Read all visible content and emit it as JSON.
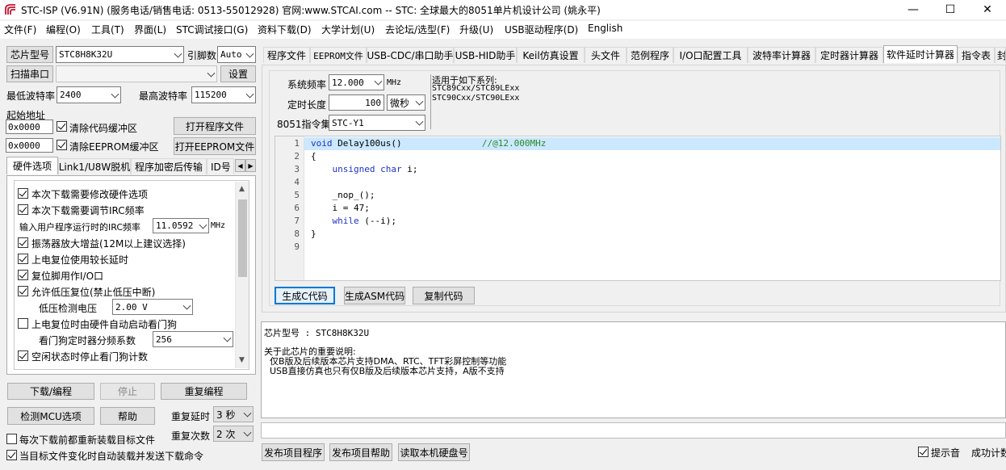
{
  "window": {
    "title": "STC-ISP (V6.91N) (服务电话/销售电话: 0513-55012928) 官网:www.STCAI.com  -- STC: 全球最大的8051单片机设计公司 (姚永平)",
    "minimize": "—",
    "maximize": "☐",
    "close": "✕"
  },
  "menu": [
    "文件(F)",
    "编程(O)",
    "工具(T)",
    "界面(L)",
    "STC调试接口(G)",
    "资料下载(D)",
    "大学计划(U)",
    "去论坛/选型(F)",
    "升级(U)",
    "USB驱动程序(D)",
    "English"
  ],
  "left": {
    "chip_model_label": "芯片型号",
    "chip_model_value": "STC8H8K32U",
    "pin_count_label": "引脚数",
    "pin_count_value": "Auto",
    "scan_port_label": "扫描串口",
    "port_value": "",
    "settings_label": "设置",
    "min_baud_label": "最低波特率",
    "min_baud_value": "2400",
    "max_baud_label": "最高波特率",
    "max_baud_value": "115200",
    "start_addr_label": "起始地址",
    "addr1": "0x0000",
    "clear_code_label": "清除代码缓冲区",
    "open_prog_label": "打开程序文件",
    "addr2": "0x0000",
    "clear_eeprom_label": "清除EEPROM缓冲区",
    "open_eeprom_label": "打开EEPROM文件",
    "tabs": [
      "硬件选项",
      "Link1/U8W脱机",
      "程序加密后传输",
      "ID号"
    ],
    "hw_options": [
      {
        "label": "本次下载需要修改硬件选项",
        "checked": true
      },
      {
        "label": "本次下载需要调节IRC频率",
        "checked": true
      }
    ],
    "irc_label": "输入用户程序运行时的IRC频率",
    "irc_value": "11.0592",
    "irc_unit": "MHz",
    "hw_options2": [
      {
        "label": "振荡器放大增益(12M以上建议选择)",
        "checked": true
      },
      {
        "label": "上电复位使用较长延时",
        "checked": true
      },
      {
        "label": "复位脚用作I/O口",
        "checked": true
      },
      {
        "label": "允许低压复位(禁止低压中断)",
        "checked": true
      }
    ],
    "lv_label": "低压检测电压",
    "lv_value": "2.00 V",
    "wdt_auto_label": "上电复位时由硬件自动启动看门狗",
    "wdt_div_label": "看门狗定时器分频系数",
    "wdt_div_value": "256",
    "idle_wdt_label": "空闲状态时停止看门狗计数",
    "download_label": "下载/编程",
    "stop_label": "停止",
    "reprog_label": "重复编程",
    "detect_label": "检测MCU选项",
    "help_label": "帮助",
    "repeat_delay_label": "重复延时",
    "repeat_delay_value": "3 秒",
    "repeat_count_label": "重复次数",
    "repeat_count_value": "2 次",
    "reload_label": "每次下载前都重新装载目标文件",
    "auto_reload_label": "当目标文件变化时自动装载并发送下载命令"
  },
  "right": {
    "tabs": [
      "程序文件",
      "EEPROM文件",
      "USB-CDC/串口助手",
      "USB-HID助手",
      "Keil仿真设置",
      "头文件",
      "范例程序",
      "I/O口配置工具",
      "波特率计算器",
      "定时器计算器",
      "软件延时计算器",
      "指令表",
      "封"
    ],
    "sys_freq_label": "系统频率",
    "sys_freq_value": "12.000",
    "sys_freq_unit": "MHz",
    "duration_label": "定时长度",
    "duration_value": "100",
    "duration_unit": "微秒",
    "isa_label": "8051指令集",
    "isa_value": "STC-Y1",
    "applies_title": "适用于如下系列:",
    "applies_1": "STC89Cxx/STC89LExx",
    "applies_2": "STC90Cxx/STC90LExx",
    "code_lines": [
      {
        "n": "1",
        "parts": [
          [
            "kw",
            "void"
          ],
          [
            "tx",
            " Delay100us()"
          ],
          [
            "tx",
            "\t\t"
          ],
          [
            "cm",
            "//@12.000MHz"
          ]
        ]
      },
      {
        "n": "2",
        "parts": [
          [
            "tx",
            "{"
          ]
        ]
      },
      {
        "n": "3",
        "parts": [
          [
            "tx",
            "    "
          ],
          [
            "kw",
            "unsigned char"
          ],
          [
            "tx",
            " i;"
          ]
        ]
      },
      {
        "n": "4",
        "parts": [
          [
            "tx",
            ""
          ]
        ]
      },
      {
        "n": "5",
        "parts": [
          [
            "tx",
            "    _nop_();"
          ]
        ]
      },
      {
        "n": "6",
        "parts": [
          [
            "tx",
            "    i = 47;"
          ]
        ]
      },
      {
        "n": "7",
        "parts": [
          [
            "tx",
            "    "
          ],
          [
            "kw",
            "while"
          ],
          [
            "tx",
            " (--i);"
          ]
        ]
      },
      {
        "n": "8",
        "parts": [
          [
            "tx",
            "}"
          ]
        ]
      },
      {
        "n": "9",
        "parts": [
          [
            "tx",
            ""
          ]
        ]
      }
    ],
    "gen_c_label": "生成C代码",
    "gen_asm_label": "生成ASM代码",
    "copy_label": "复制代码",
    "info_chip": "芯片型号 : STC8H8K32U",
    "info_notice": "关于此芯片的重要说明:",
    "info_1": "  仅B版及后续版本芯片支持DMA、RTC、TFT彩屏控制等功能",
    "info_2": "  USB直接仿真也只有仅B版及后续版本芯片支持，A版不支持",
    "publish_prog_label": "发布项目程序",
    "publish_help_label": "发布项目帮助",
    "read_disk_label": "读取本机硬盘号",
    "beep_label": "提示音",
    "success_count_label": "成功计数"
  },
  "colors": {
    "highlight": "#cce8ff",
    "keyword": "#1e32c8",
    "comment": "#2a8a2a"
  }
}
